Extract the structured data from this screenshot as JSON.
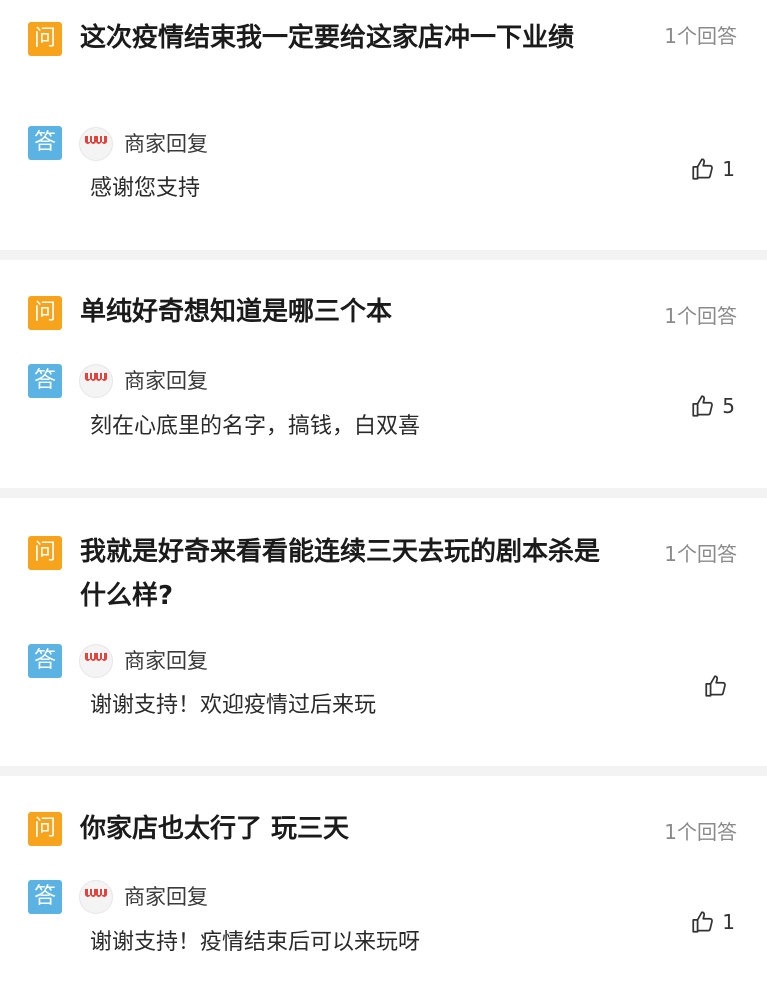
{
  "labels": {
    "question_badge": "问",
    "answer_badge": "答"
  },
  "items": [
    {
      "question": "这次疫情结束我一定要给这家店冲一下业绩",
      "answer_count": "1个回答",
      "merchant_label": "商家回复",
      "reply": "感谢您支持",
      "likes": "1"
    },
    {
      "question": "单纯好奇想知道是哪三个本",
      "answer_count": "1个回答",
      "merchant_label": "商家回复",
      "reply": "刻在心底里的名字，搞钱，白双喜",
      "likes": "5"
    },
    {
      "question": "我就是好奇来看看能连续三天去玩的剧本杀是什么样?",
      "answer_count": "1个回答",
      "merchant_label": "商家回复",
      "reply": "谢谢支持！欢迎疫情过后来玩",
      "likes": ""
    },
    {
      "question": "你家店也太行了 玩三天",
      "answer_count": "1个回答",
      "merchant_label": "商家回复",
      "reply": "谢谢支持！疫情结束后可以来玩呀",
      "likes": "1"
    }
  ],
  "icons": {
    "like": "thumbs-up-icon",
    "avatar": "merchant-storefront-icon"
  },
  "colors": {
    "question_badge": "#f7a41c",
    "answer_badge": "#5bb3e3",
    "separator": "#f3f3f3",
    "awning": "#e8403a"
  }
}
